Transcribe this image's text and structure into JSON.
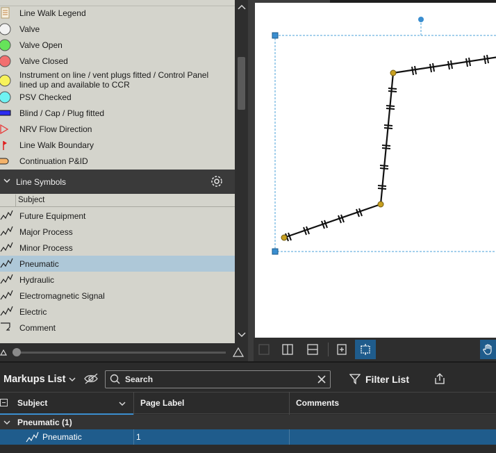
{
  "legend": {
    "items": [
      {
        "label": "Line Walk Legend",
        "icon": "document-icon"
      },
      {
        "label": "Valve",
        "icon": "circle-white-icon",
        "color": "#f2f2f2"
      },
      {
        "label": "Valve Open",
        "icon": "circle-green-icon",
        "color": "#66e35a"
      },
      {
        "label": "Valve Closed",
        "icon": "circle-red-icon",
        "color": "#f26f6f"
      },
      {
        "label": "Instrument on line / vent plugs fitted / Control Panel lined up and available to CCR",
        "icon": "circle-yellow-icon",
        "color": "#f7f25a"
      },
      {
        "label": "PSV Checked",
        "icon": "circle-cyan-icon",
        "color": "#6ff2f2"
      },
      {
        "label": "Blind / Cap / Plug fitted",
        "icon": "blue-bar-icon",
        "color": "#2c2cf0"
      },
      {
        "label": "NRV Flow Direction",
        "icon": "triangle-red-icon",
        "color": "#e83a3a"
      },
      {
        "label": "Line Walk Boundary",
        "icon": "flag-red-icon",
        "color": "#e01e1e"
      },
      {
        "label": "Continuation P&ID",
        "icon": "pill-orange-icon",
        "color": "#f4b36a"
      }
    ]
  },
  "line_symbols": {
    "title": "Line Symbols",
    "column_subject": "Subject",
    "items": [
      {
        "label": "Future Equipment"
      },
      {
        "label": "Major Process"
      },
      {
        "label": "Minor Process"
      },
      {
        "label": "Pneumatic"
      },
      {
        "label": "Hydraulic"
      },
      {
        "label": "Electromagnetic Signal"
      },
      {
        "label": "Electric"
      },
      {
        "label": "Comment"
      }
    ],
    "selected": "Pneumatic"
  },
  "markups": {
    "title": "Markups List",
    "search_placeholder": "Search",
    "filter_label": "Filter List",
    "columns": [
      "Subject",
      "Page Label",
      "Comments"
    ],
    "group": "Pneumatic (1)",
    "rows": [
      {
        "subject": "Pneumatic",
        "page_label": "1",
        "comments": ""
      }
    ]
  },
  "colors": {
    "accent": "#1f5c8c",
    "selection": "#aec8d8",
    "panel_bg": "#d4d4cc"
  }
}
